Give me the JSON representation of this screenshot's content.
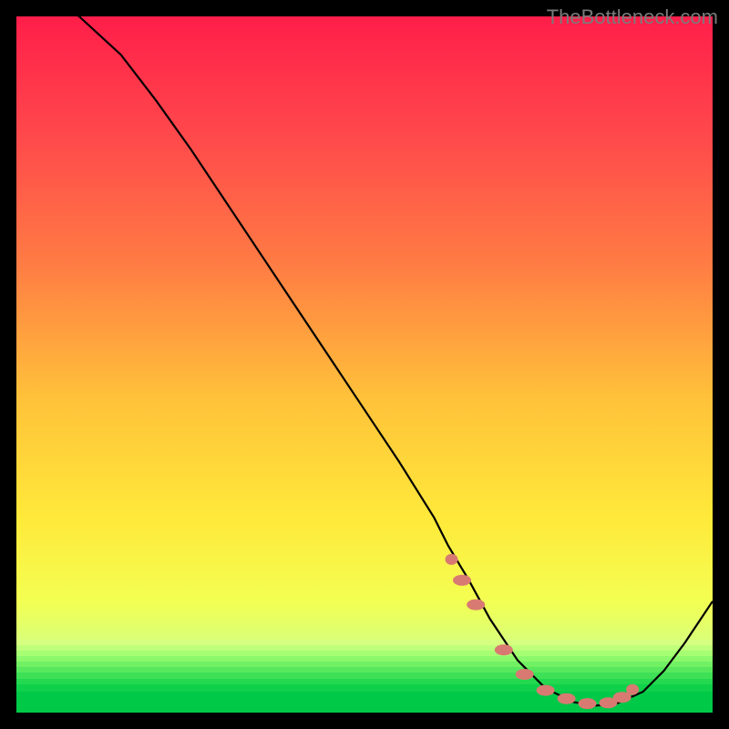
{
  "watermark": "TheBottleneck.com",
  "chart_data": {
    "type": "line",
    "title": "",
    "xlabel": "",
    "ylabel": "",
    "xlim": [
      0,
      100
    ],
    "ylim": [
      0,
      100
    ],
    "series": [
      {
        "name": "bottleneck-curve",
        "x": [
          0,
          9,
          15,
          20,
          25,
          30,
          35,
          40,
          45,
          50,
          55,
          60,
          62,
          65,
          68,
          72,
          76,
          80,
          83,
          86,
          90,
          93,
          96,
          100
        ],
        "y": [
          106,
          100,
          94.5,
          88,
          81,
          73.5,
          66,
          58.5,
          51,
          43.5,
          36,
          28,
          24,
          19,
          13.5,
          7.5,
          3.5,
          1.5,
          1,
          1.2,
          3,
          6,
          10,
          16
        ]
      }
    ],
    "markers": {
      "name": "highlight-points",
      "color": "#d97a72",
      "x": [
        62.5,
        64,
        66,
        70,
        73,
        76,
        79,
        82,
        85,
        87,
        88.5
      ],
      "y": [
        22,
        19,
        15.5,
        9,
        5.5,
        3.2,
        2,
        1.3,
        1.4,
        2.2,
        3.3
      ]
    },
    "gradient_stops": [
      {
        "offset": 0,
        "color": "#ff1e4a"
      },
      {
        "offset": 18,
        "color": "#ff4b4b"
      },
      {
        "offset": 35,
        "color": "#ff7a44"
      },
      {
        "offset": 55,
        "color": "#ffc23a"
      },
      {
        "offset": 72,
        "color": "#ffe93a"
      },
      {
        "offset": 84,
        "color": "#f3ff52"
      },
      {
        "offset": 90,
        "color": "#d8ff7a"
      },
      {
        "offset": 100,
        "color": "#00e05a"
      }
    ],
    "green_bands": [
      {
        "y_from": 89.5,
        "y_to": 90.3,
        "color": "#d6ff80"
      },
      {
        "y_from": 90.3,
        "y_to": 91.1,
        "color": "#bfff79"
      },
      {
        "y_from": 91.1,
        "y_to": 91.9,
        "color": "#a6ff72"
      },
      {
        "y_from": 91.9,
        "y_to": 92.7,
        "color": "#8cf86b"
      },
      {
        "y_from": 92.7,
        "y_to": 93.5,
        "color": "#72f064"
      },
      {
        "y_from": 93.5,
        "y_to": 94.3,
        "color": "#58e85d"
      },
      {
        "y_from": 94.3,
        "y_to": 95.2,
        "color": "#3ee056"
      },
      {
        "y_from": 95.2,
        "y_to": 96.0,
        "color": "#24d84f"
      },
      {
        "y_from": 96.0,
        "y_to": 97.0,
        "color": "#0fd04a"
      },
      {
        "y_from": 97.0,
        "y_to": 100,
        "color": "#00c948"
      }
    ]
  }
}
